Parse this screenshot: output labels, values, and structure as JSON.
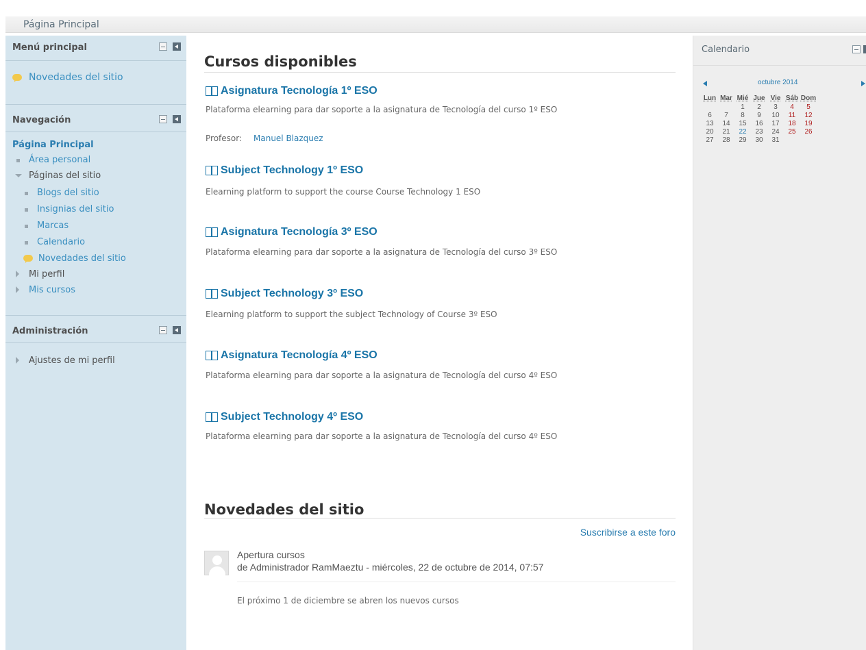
{
  "breadcrumb": {
    "home": "Página Principal"
  },
  "main_menu": {
    "title": "Menú principal",
    "items": [
      {
        "label": "Novedades del sitio"
      }
    ]
  },
  "navigation": {
    "title": "Navegación",
    "home": "Página Principal",
    "items": [
      "Área personal",
      "Páginas del sitio",
      "Blogs del sitio",
      "Insignias del sitio",
      "Marcas",
      "Calendario",
      "Novedades del sitio",
      "Mi perfil",
      "Mis cursos"
    ]
  },
  "administration": {
    "title": "Administración",
    "items": [
      "Ajustes de mi perfil"
    ]
  },
  "courses": {
    "heading": "Cursos disponibles",
    "list": [
      {
        "title": "Asignatura Tecnología 1º ESO",
        "summary": "Plataforma elearning para dar soporte a la asignatura de Tecnología del curso 1º ESO",
        "teacher_label": "Profesor:",
        "teacher_name": "Manuel Blazquez"
      },
      {
        "title": "Subject Technology 1º ESO",
        "summary": "Elearning platform to support the course Course Technology 1 ESO"
      },
      {
        "title": "Asignatura Tecnología 3º ESO",
        "summary": "Plataforma elearning para dar soporte a la asignatura de Tecnología del curso 3º ESO"
      },
      {
        "title": "Subject Technology 3º ESO",
        "summary": "Elearning platform to support the subject Technology of Course 3º ESO"
      },
      {
        "title": "Asignatura Tecnología 4º ESO",
        "summary": "Plataforma elearning para dar soporte a la asignatura de Tecnología del curso 4º ESO"
      },
      {
        "title": "Subject Technology 4º ESO",
        "summary": "Plataforma elearning para dar soporte a la asignatura de Tecnología del curso 4º ESO"
      }
    ]
  },
  "news": {
    "heading": "Novedades del sitio",
    "subscribe": "Suscribirse a este foro",
    "post": {
      "subject": "Apertura cursos",
      "byline": "de Administrador RamMaeztu - miércoles, 22 de octubre de 2014, 07:57",
      "body": "El próximo 1 de diciembre se abren los nuevos cursos"
    }
  },
  "calendar": {
    "title": "Calendario",
    "month": "octubre 2014",
    "weekdays": [
      "Lun",
      "Mar",
      "Mié",
      "Jue",
      "Vie",
      "Sáb",
      "Dom"
    ],
    "weeks": [
      [
        "",
        "",
        "1",
        "2",
        "3",
        "4",
        "5"
      ],
      [
        "6",
        "7",
        "8",
        "9",
        "10",
        "11",
        "12"
      ],
      [
        "13",
        "14",
        "15",
        "16",
        "17",
        "18",
        "19"
      ],
      [
        "20",
        "21",
        "22",
        "23",
        "24",
        "25",
        "26"
      ],
      [
        "27",
        "28",
        "29",
        "30",
        "31",
        "",
        ""
      ]
    ],
    "event_day": "22",
    "weekend_color": "#b02020",
    "link_color": "#2a7db0"
  }
}
